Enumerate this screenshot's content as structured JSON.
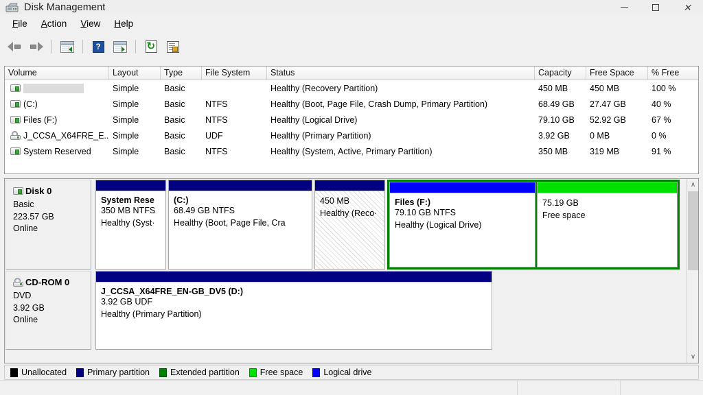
{
  "window": {
    "title": "Disk Management",
    "icon": "disk-management-icon",
    "controls": {
      "minimize": "–",
      "maximize": "□",
      "close": "✕"
    }
  },
  "menu": {
    "items": [
      "File",
      "Action",
      "View",
      "Help"
    ]
  },
  "toolbar": {
    "items": [
      {
        "name": "back-icon",
        "tip": "Back"
      },
      {
        "name": "forward-icon",
        "tip": "Forward"
      },
      {
        "name": "show-hide-console-tree-icon",
        "tip": "Show/Hide Console Tree"
      },
      {
        "name": "help-icon",
        "tip": "Help"
      },
      {
        "name": "show-hide-action-pane-icon",
        "tip": "Show/Hide Action Pane"
      },
      {
        "name": "refresh-icon",
        "tip": "Refresh"
      },
      {
        "name": "rescan-disks-icon",
        "tip": "Rescan Disks"
      }
    ]
  },
  "volume_list": {
    "columns": [
      "Volume",
      "Layout",
      "Type",
      "File System",
      "Status",
      "Capacity",
      "Free Space",
      "% Free"
    ],
    "rows": [
      {
        "volume": "",
        "selected": true,
        "icon": "partition-icon",
        "layout": "Simple",
        "type": "Basic",
        "file_system": "",
        "status": "Healthy (Recovery Partition)",
        "capacity": "450 MB",
        "free_space": "450 MB",
        "percent_free": "100 %"
      },
      {
        "volume": "(C:)",
        "selected": false,
        "icon": "partition-icon",
        "layout": "Simple",
        "type": "Basic",
        "file_system": "NTFS",
        "status": "Healthy (Boot, Page File, Crash Dump, Primary Partition)",
        "capacity": "68.49 GB",
        "free_space": "27.47 GB",
        "percent_free": "40 %"
      },
      {
        "volume": "Files (F:)",
        "selected": false,
        "icon": "partition-icon",
        "layout": "Simple",
        "type": "Basic",
        "file_system": "NTFS",
        "status": "Healthy (Logical Drive)",
        "capacity": "79.10 GB",
        "free_space": "52.92 GB",
        "percent_free": "67 %"
      },
      {
        "volume": "J_CCSA_X64FRE_E...",
        "selected": false,
        "icon": "cdrom-icon",
        "layout": "Simple",
        "type": "Basic",
        "file_system": "UDF",
        "status": "Healthy (Primary Partition)",
        "capacity": "3.92 GB",
        "free_space": "0 MB",
        "percent_free": "0 %"
      },
      {
        "volume": "System Reserved",
        "selected": false,
        "icon": "partition-icon",
        "layout": "Simple",
        "type": "Basic",
        "file_system": "NTFS",
        "status": "Healthy (System, Active, Primary Partition)",
        "capacity": "350 MB",
        "free_space": "319 MB",
        "percent_free": "91 %"
      }
    ]
  },
  "graphical_view": {
    "disks": [
      {
        "name": "Disk 0",
        "icon": "disk-icon",
        "type": "Basic",
        "size": "223.57 GB",
        "state": "Online",
        "partitions": [
          {
            "name": "System Rese",
            "line2": "350 MB NTFS",
            "line3": "Healthy (Syst·",
            "kind": "primary",
            "selected": false
          },
          {
            "name": "(C:)",
            "line2": "68.49 GB NTFS",
            "line3": "Healthy (Boot, Page File, Cra",
            "kind": "primary",
            "selected": false
          },
          {
            "name": "",
            "line2": "450 MB",
            "line3": "Healthy (Reco·",
            "kind": "primary",
            "selected": true
          }
        ],
        "extended": {
          "partitions": [
            {
              "name": "Files  (F:)",
              "line2": "79.10 GB NTFS",
              "line3": "Healthy (Logical Drive)",
              "kind": "logical",
              "selected": false
            },
            {
              "name": "",
              "line2": "75.19 GB",
              "line3": "Free space",
              "kind": "free",
              "selected": false
            }
          ]
        }
      },
      {
        "name": "CD-ROM 0",
        "icon": "cdrom-icon",
        "type": "DVD",
        "size": "3.92 GB",
        "state": "Online",
        "partitions": [
          {
            "name": "J_CCSA_X64FRE_EN-GB_DV5  (D:)",
            "line2": "3.92 GB UDF",
            "line3": "Healthy (Primary Partition)",
            "kind": "primary",
            "selected": false
          }
        ],
        "extended": null
      }
    ],
    "scrollbar": {
      "up": "∧",
      "down": "∨"
    }
  },
  "legend": {
    "items": [
      {
        "label": "Unallocated",
        "color": "#000000"
      },
      {
        "label": "Primary partition",
        "color": "#000080"
      },
      {
        "label": "Extended partition",
        "color": "#008000"
      },
      {
        "label": "Free space",
        "color": "#00e000"
      },
      {
        "label": "Logical drive",
        "color": "#0000ff"
      }
    ]
  },
  "status_bar": {
    "segments": [
      "",
      "",
      ""
    ]
  }
}
